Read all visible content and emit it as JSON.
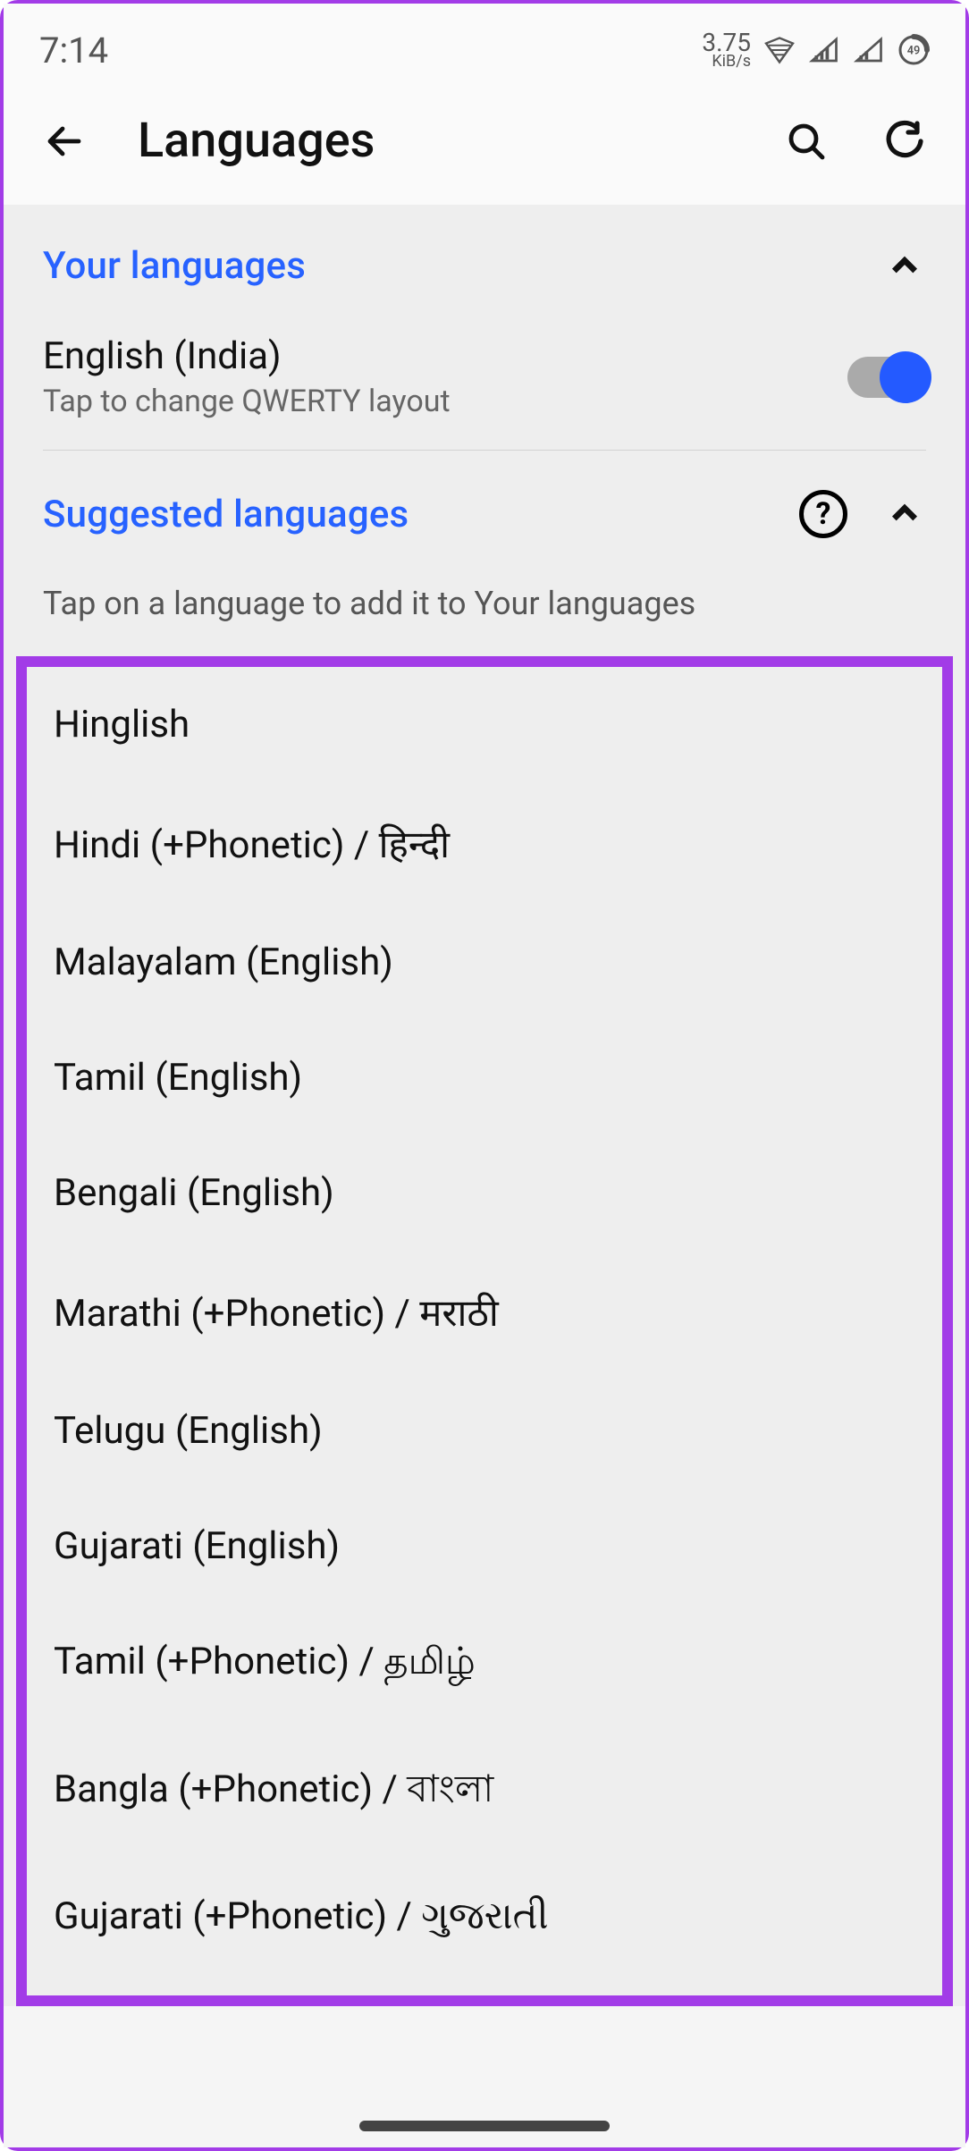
{
  "status": {
    "time": "7:14",
    "net_speed_value": "3.75",
    "net_speed_unit": "KiB/s",
    "battery_label": "49"
  },
  "appbar": {
    "title": "Languages"
  },
  "sections": {
    "your_languages": {
      "label": "Your languages",
      "items": [
        {
          "name": "English (India)",
          "sub": "Tap to change QWERTY layout",
          "enabled": true
        }
      ]
    },
    "suggested": {
      "label": "Suggested languages",
      "hint": "Tap on a language to add it to Your languages",
      "items": [
        "Hinglish",
        "Hindi (+Phonetic) / हिन्दी",
        "Malayalam (English)",
        "Tamil (English)",
        "Bengali (English)",
        "Marathi (+Phonetic) / मराठी",
        "Telugu (English)",
        "Gujarati (English)",
        "Tamil (+Phonetic) / தமிழ்",
        "Bangla (+Phonetic) / বাংলা",
        "Gujarati (+Phonetic) / ગુજરાતી"
      ]
    }
  }
}
